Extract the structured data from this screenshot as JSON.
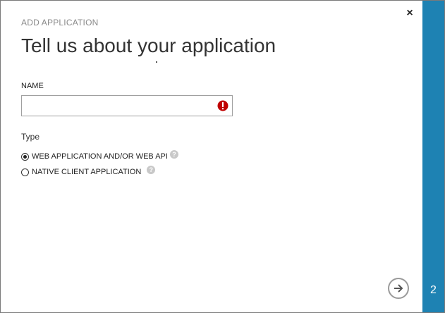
{
  "dialog": {
    "subtitle": "ADD APPLICATION",
    "title": "Tell us about your application",
    "close_symbol": "×",
    "step_number": "2"
  },
  "form": {
    "name_label": "NAME",
    "name_value": "",
    "name_error_icon": "error-exclamation-icon",
    "type_label": "Type",
    "options": [
      {
        "label": "WEB APPLICATION AND/OR WEB API",
        "selected": true,
        "help": "?"
      },
      {
        "label": "NATIVE CLIENT APPLICATION",
        "selected": false,
        "help": "?"
      }
    ]
  },
  "footer": {
    "next_icon": "arrow-right-icon"
  },
  "colors": {
    "side_panel": "#1e82b3",
    "error": "#c00000",
    "help": "#c8c8c8"
  }
}
